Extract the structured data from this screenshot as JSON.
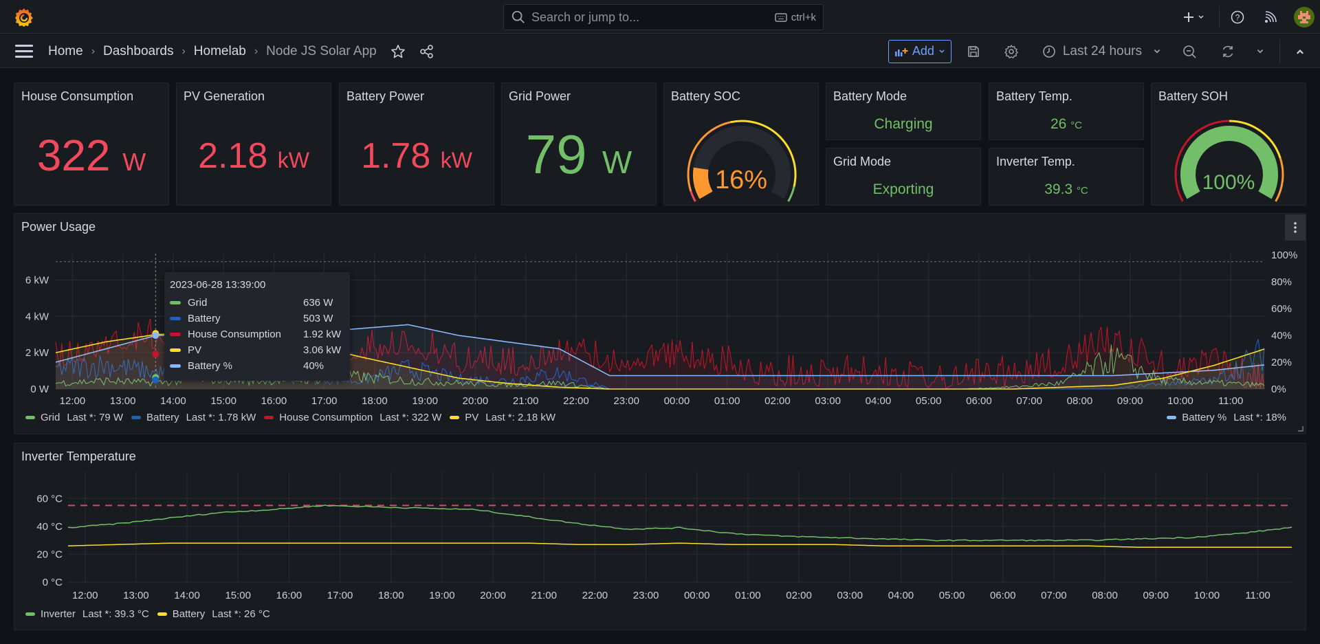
{
  "topbar": {
    "search_placeholder": "Search or jump to...",
    "search_shortcut": "ctrl+k"
  },
  "breadcrumb": {
    "items": [
      "Home",
      "Dashboards",
      "Homelab"
    ],
    "current": "Node JS Solar App"
  },
  "toolbar": {
    "add_label": "Add",
    "time_range": "Last 24 hours"
  },
  "colors": {
    "red": "#f2495c",
    "green": "#73bf69",
    "orange": "#ff9830",
    "yellow": "#fade2a",
    "blue": "#1f60c4",
    "light_blue": "#8ab8ff",
    "dark_red": "#c4162a"
  },
  "stats": {
    "house": {
      "title": "House Consumption",
      "value": "322",
      "unit": "W"
    },
    "pv": {
      "title": "PV Generation",
      "value": "2.18",
      "unit": "kW"
    },
    "battery_power": {
      "title": "Battery Power",
      "value": "1.78",
      "unit": "kW"
    },
    "grid_power": {
      "title": "Grid Power",
      "value": "79",
      "unit": "W"
    },
    "battery_soc": {
      "title": "Battery SOC",
      "value": "16%",
      "percent": 16
    },
    "battery_mode": {
      "title": "Battery Mode",
      "value": "Charging"
    },
    "grid_mode": {
      "title": "Grid Mode",
      "value": "Exporting"
    },
    "battery_temp": {
      "title": "Battery Temp.",
      "value": "26",
      "unit": "°C"
    },
    "inverter_temp": {
      "title": "Inverter Temp.",
      "value": "39.3",
      "unit": "°C"
    },
    "battery_soh": {
      "title": "Battery SOH",
      "value": "100%",
      "percent": 100
    }
  },
  "chart_data": [
    {
      "type": "line",
      "title": "Power Usage",
      "x_ticks": [
        "12:00",
        "13:00",
        "14:00",
        "15:00",
        "16:00",
        "17:00",
        "18:00",
        "19:00",
        "20:00",
        "21:00",
        "22:00",
        "23:00",
        "00:00",
        "01:00",
        "02:00",
        "03:00",
        "04:00",
        "05:00",
        "06:00",
        "07:00",
        "08:00",
        "09:00",
        "10:00",
        "11:00"
      ],
      "y_left_ticks": [
        "0 W",
        "2 kW",
        "4 kW",
        "6 kW"
      ],
      "y_left_range_kw": [
        0,
        7
      ],
      "y_right_ticks": [
        "0%",
        "20%",
        "40%",
        "60%",
        "80%",
        "100%"
      ],
      "y_right_range_pct": [
        0,
        100
      ],
      "x_hours": [
        "11:40",
        "11:40 next day"
      ],
      "series": [
        {
          "name": "Grid",
          "color": "#73bf69",
          "last": "Last *: 79 W",
          "approx_kw": [
            0.3,
            0.4,
            0.3,
            0.5,
            0.4,
            0.5,
            0.6,
            0.4,
            0.3,
            0.2,
            0.3,
            0.0,
            0.0,
            0.0,
            0.0,
            0.0,
            0.0,
            0.0,
            0.0,
            0.1,
            0.3,
            1.5,
            0.4,
            0.3,
            0.2
          ]
        },
        {
          "name": "Battery",
          "color": "#1f60c4",
          "last": "Last *: 1.78 kW",
          "approx_kw": [
            1.0,
            1.2,
            0.8,
            0.7,
            0.6,
            0.5,
            0.4,
            1.0,
            0.5,
            0.4,
            0.8,
            0.0,
            0.0,
            0.0,
            0.0,
            0.0,
            0.0,
            0.0,
            0.0,
            0.0,
            0.0,
            0.0,
            0.3,
            0.4,
            1.8
          ]
        },
        {
          "name": "House Consumption",
          "color": "#c4162a",
          "last": "Last *: 322 W",
          "approx_kw": [
            1.5,
            2.5,
            2.8,
            2.5,
            2.3,
            2.5,
            2.0,
            2.5,
            1.5,
            1.2,
            2.0,
            1.5,
            1.8,
            1.5,
            0.7,
            0.7,
            0.7,
            0.6,
            0.6,
            0.7,
            1.3,
            2.5,
            1.0,
            1.2,
            0.3
          ]
        },
        {
          "name": "PV",
          "color": "#fade2a",
          "last": "Last *: 2.18 kW",
          "approx_kw": [
            2.0,
            2.6,
            3.0,
            3.1,
            3.0,
            2.5,
            1.8,
            1.2,
            0.6,
            0.3,
            0.1,
            0.0,
            0.0,
            0.0,
            0.0,
            0.0,
            0.0,
            0.0,
            0.0,
            0.0,
            0.1,
            0.2,
            0.6,
            1.3,
            2.2
          ]
        },
        {
          "name": "Battery %",
          "color": "#8ab8ff",
          "axis": "right",
          "last": "Last *: 18%",
          "approx_pct": [
            20,
            30,
            40,
            40,
            40,
            42,
            45,
            48,
            40,
            35,
            30,
            10,
            10,
            10,
            10,
            10,
            10,
            10,
            10,
            10,
            10,
            10,
            12,
            14,
            18
          ]
        }
      ],
      "threshold_pct": 95,
      "tooltip": {
        "time": "2023-06-28 13:39:00",
        "rows": [
          {
            "name": "Grid",
            "value": "636 W",
            "color": "#73bf69"
          },
          {
            "name": "Battery",
            "value": "503 W",
            "color": "#1f60c4"
          },
          {
            "name": "House Consumption",
            "value": "1.92 kW",
            "color": "#c4162a"
          },
          {
            "name": "PV",
            "value": "3.06 kW",
            "color": "#fade2a"
          },
          {
            "name": "Battery %",
            "value": "40%",
            "color": "#8ab8ff"
          }
        ]
      }
    },
    {
      "type": "line",
      "title": "Inverter Temperature",
      "x_ticks": [
        "12:00",
        "13:00",
        "14:00",
        "15:00",
        "16:00",
        "17:00",
        "18:00",
        "19:00",
        "20:00",
        "21:00",
        "22:00",
        "23:00",
        "00:00",
        "01:00",
        "02:00",
        "03:00",
        "04:00",
        "05:00",
        "06:00",
        "07:00",
        "08:00",
        "09:00",
        "10:00",
        "11:00"
      ],
      "y_ticks": [
        "0 °C",
        "20 °C",
        "40 °C",
        "60 °C"
      ],
      "y_range": [
        0,
        70
      ],
      "threshold": 55,
      "series": [
        {
          "name": "Inverter",
          "color": "#73bf69",
          "last": "Last *: 39.3 °C",
          "approx_values": [
            39,
            42,
            46,
            50,
            52,
            55,
            54,
            53,
            52,
            47,
            42,
            38,
            39,
            35,
            33,
            32,
            31,
            30,
            30,
            30,
            30,
            31,
            32,
            35,
            39.3
          ]
        },
        {
          "name": "Battery",
          "color": "#fade2a",
          "last": "Last *: 26 °C",
          "approx_values": [
            26,
            27,
            28,
            28,
            28,
            28,
            28,
            28,
            28,
            28,
            27,
            27,
            28,
            27,
            27,
            27,
            26,
            26,
            26,
            26,
            26,
            25,
            25,
            25,
            25
          ]
        }
      ]
    }
  ]
}
